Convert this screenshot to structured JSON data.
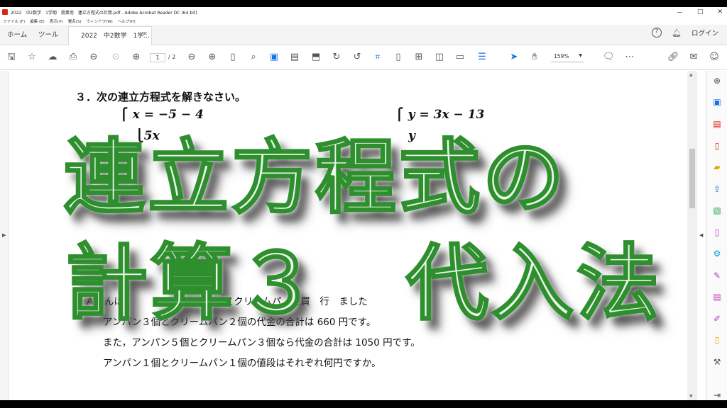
{
  "window": {
    "title": "2022　中2数学　1学期　授業用　連立方程式の計算.pdf - Adobe Acrobat Reader DC (64-bit)",
    "minimize": "－",
    "maximize": "□",
    "close": "✕"
  },
  "menu": [
    "ファイル (F)",
    "編集 (E)",
    "表示(V)",
    "署名(S)",
    "ウィンドウ(W)",
    "ヘルプ(H)"
  ],
  "tabs": {
    "home": "ホーム",
    "tools": "ツール",
    "document": "2022　中2数学　1学...",
    "close": "×",
    "login": "ログイン"
  },
  "toolbar": {
    "current_page": "1",
    "total_pages": "/ 2",
    "zoom": "159%"
  },
  "document": {
    "question_heading": "３．次の連立方程式を解きなさい。",
    "eq_left_1": "⎧ x = −5 − 4",
    "eq_left_2": "⎩5x",
    "eq_right_1": "⎧ y = 3x − 13",
    "eq_right_2": "y",
    "problem_line_1": "Ａさんは，　　　用にア　　　ンとクリームパ　を買　行　ました",
    "problem_line_2": "アンパン３個とクリームパン２個の代金の合計は 660 円です。",
    "problem_line_3": "また，アンパン５個とクリームパン３個なら代金の合計は 1050 円です。",
    "problem_line_4": "アンパン１個とクリームパン１個の値段はそれぞれ何円ですか。"
  },
  "overlay": {
    "line1": "連立方程式の",
    "line2": "計算３　代入法"
  },
  "colors": {
    "overlay_fill": "#e9f8ea",
    "overlay_stroke": "#2f8f2f",
    "accent_blue": "#1473e6",
    "acrobat_red": "#d9241c"
  }
}
